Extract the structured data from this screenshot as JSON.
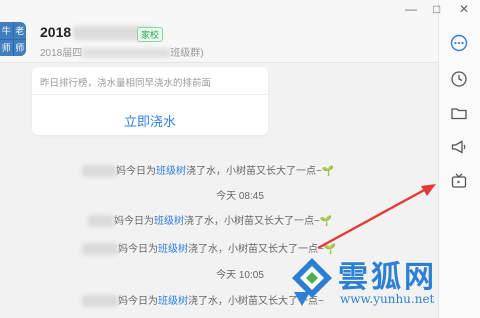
{
  "header": {
    "title": "2018",
    "badge": "家校",
    "subtitle_prefix": "2018届四",
    "subtitle_suffix": "班级群)"
  },
  "avatar": {
    "cells": [
      "牛",
      "老",
      "师",
      "师"
    ]
  },
  "card": {
    "description": "昨日排行榜，浇水量相同早浇水的排前面",
    "action_label": "立即浇水"
  },
  "messages": [
    {
      "prefix": "妈今日为",
      "link": "班级树",
      "suffix": "浇了水，小树苗又长大了一点~"
    },
    {
      "prefix": "妈今日为",
      "link": "班级树",
      "suffix": "浇了水，小树苗又长大了一点~"
    },
    {
      "prefix": "妈今日为",
      "link": "班级树",
      "suffix": "浇了水，小树苗又长大了一点~"
    },
    {
      "prefix": "妈今日为",
      "link": "班级树",
      "suffix": "浇了水，小树苗又长大了一点~"
    }
  ],
  "timestamps": [
    "今天 08:45",
    "今天 10:05"
  ],
  "window_controls": {
    "minimize": "—",
    "maximize": "□",
    "close": "✕"
  },
  "sidebar_icons": [
    "more-icon",
    "history-icon",
    "folder-icon",
    "announcement-icon",
    "tv-icon"
  ],
  "watermark": {
    "text": "雲狐网",
    "url": "www.yunhu.net"
  },
  "colors": {
    "accent": "#2f7fe0",
    "arrow": "#e53935",
    "badge": "#2fa84f"
  }
}
